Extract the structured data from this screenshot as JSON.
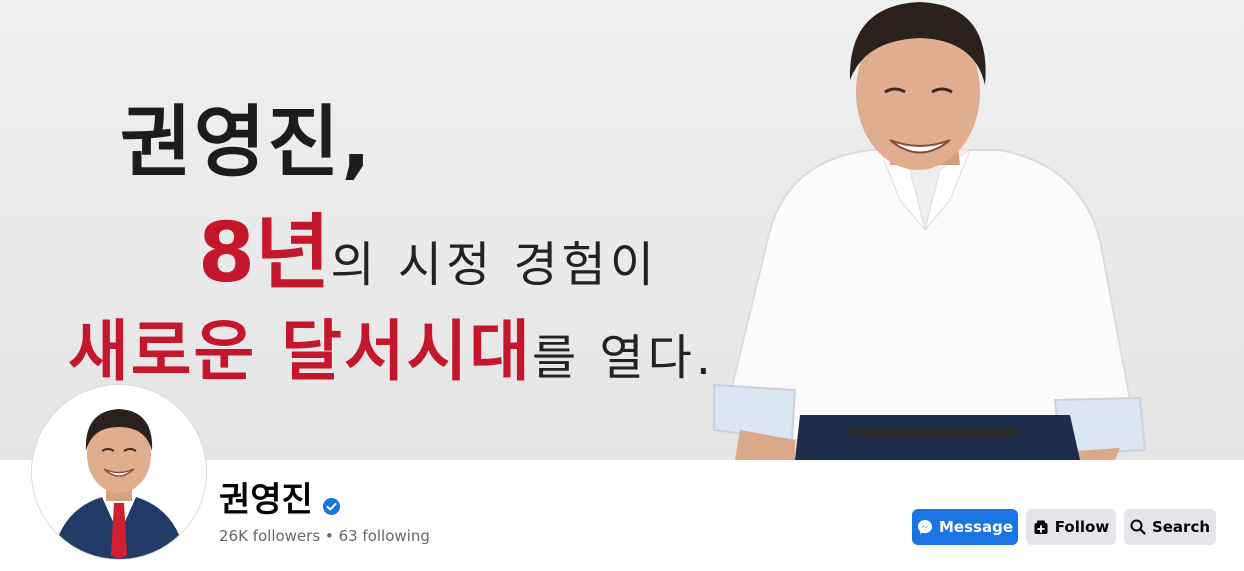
{
  "cover": {
    "line1": "권영진,",
    "line2_red": "8년",
    "line2_black": "의 시정 경험이",
    "line3_red": "새로운 달서시대",
    "line3_black": "를 열다."
  },
  "profile": {
    "name": "권영진",
    "verified_icon": "verified-badge-icon",
    "followers": "26K followers",
    "separator": "•",
    "following": "63 following"
  },
  "actions": {
    "message_label": "Message",
    "follow_label": "Follow",
    "search_label": "Search"
  },
  "colors": {
    "accent": "#1b74e4",
    "cover_red": "#c4172c",
    "secondary_button": "#e4e6eb"
  }
}
